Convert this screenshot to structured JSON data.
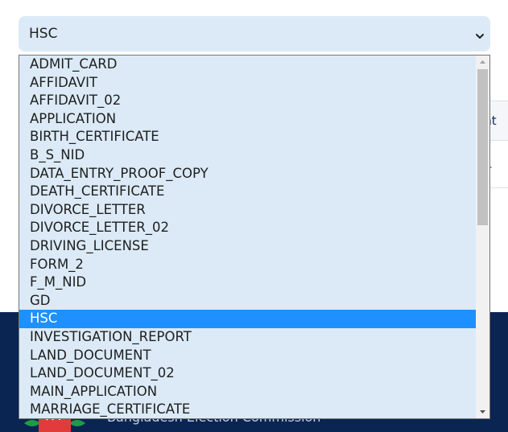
{
  "select": {
    "value": "HSC"
  },
  "dropdown": {
    "options": [
      "ADMIT_CARD",
      "AFFIDAVIT",
      "AFFIDAVIT_02",
      "APPLICATION",
      "BIRTH_CERTIFICATE",
      "B_S_NID",
      "DATA_ENTRY_PROOF_COPY",
      "DEATH_CERTIFICATE",
      "DIVORCE_LETTER",
      "DIVORCE_LETTER_02",
      "DRIVING_LICENSE",
      "FORM_2",
      "F_M_NID",
      "GD",
      "HSC",
      "INVESTIGATION_REPORT",
      "LAND_DOCUMENT",
      "LAND_DOCUMENT_02",
      "MAIN_APPLICATION",
      "MARRIAGE_CERTIFICATE"
    ],
    "selected_index": 14
  },
  "background": {
    "table_header_fragment": "ent",
    "table_cell_fragment": "rd.",
    "footer_text": "Bangladesh Election Commission"
  },
  "colors": {
    "select_bg": "#dbeaf6",
    "highlight": "#1e90ff",
    "footer_bg": "#0a2552"
  }
}
